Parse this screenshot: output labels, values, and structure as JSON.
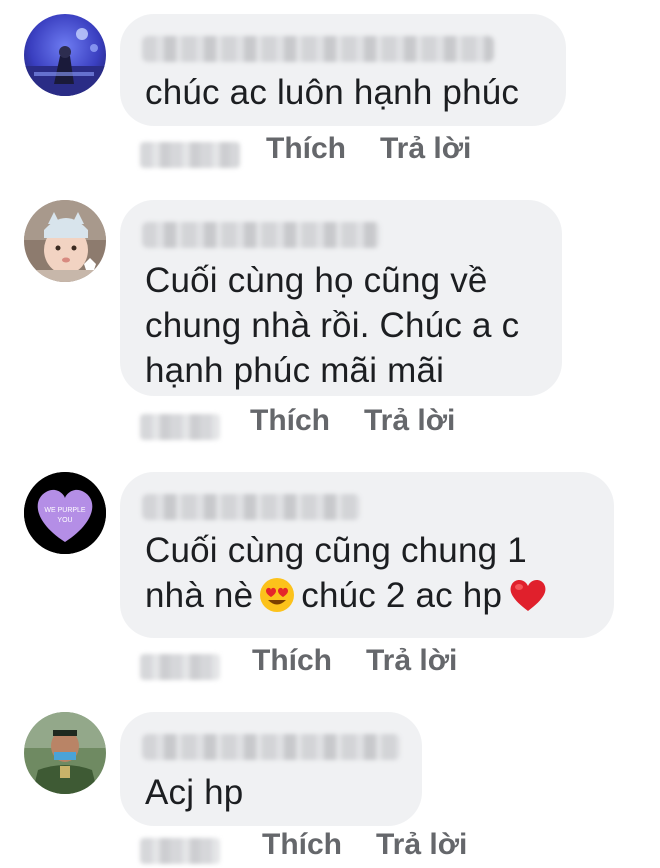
{
  "colors": {
    "bubble_bg": "#f0f1f3",
    "text": "#1c1e21",
    "action_text": "#65676b"
  },
  "comments": [
    {
      "avatar_icon": "concert-stage-avatar-icon",
      "lines": [
        "chúc ac luôn hạnh phúc"
      ],
      "like_label": "Thích",
      "reply_label": "Trả lời"
    },
    {
      "avatar_icon": "baby-photo-avatar-icon",
      "lines": [
        "Cuối cùng họ cũng về",
        "chung nhà rồi. Chúc a c",
        "hạnh phúc mãi mãi"
      ],
      "like_label": "Thích",
      "reply_label": "Trả lời"
    },
    {
      "avatar_icon": "purple-heart-avatar-icon",
      "avatar_text": "WE PURPLE YOU",
      "lines": [
        "Cuối cùng cũng chung 1",
        "nhà nè",
        "chúc 2 ac hp"
      ],
      "emojis": [
        "heart-eyes-emoji-icon",
        "red-heart-emoji-icon"
      ],
      "like_label": "Thích",
      "reply_label": "Trả lời"
    },
    {
      "avatar_icon": "soldier-photo-avatar-icon",
      "lines": [
        "Acj hp"
      ],
      "like_label": "Thích",
      "reply_label": "Trả lời"
    }
  ]
}
